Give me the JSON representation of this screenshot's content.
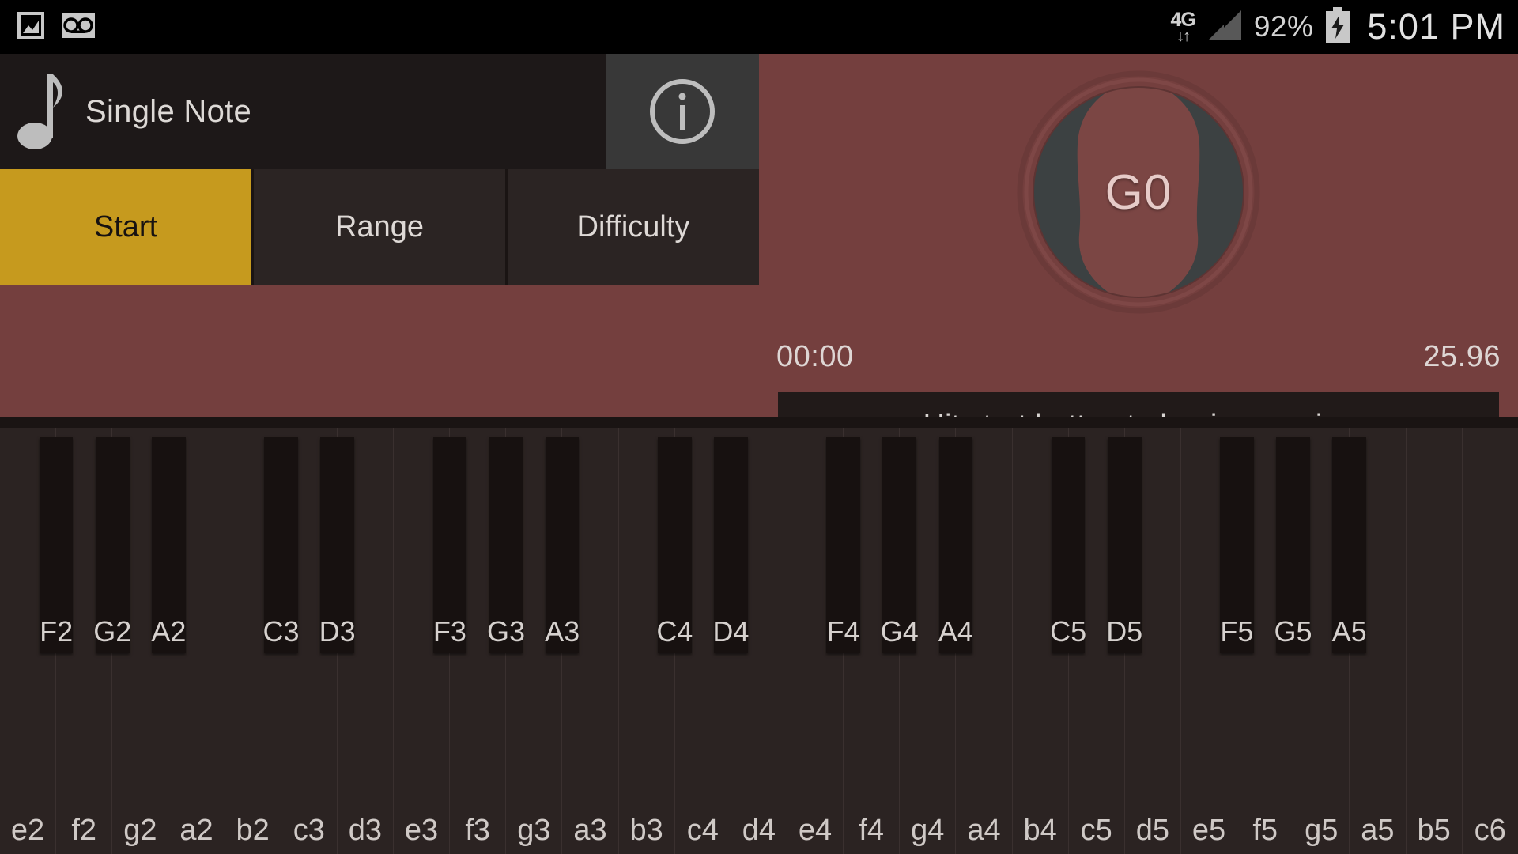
{
  "statusbar": {
    "icons": [
      "screenshot-icon",
      "voicemail-icon"
    ],
    "network_label": "4G",
    "network_arrows": "↓↑",
    "battery_percent": "92%",
    "clock": "5:01 PM"
  },
  "header": {
    "icon": "music-note-icon",
    "title": "Single Note",
    "info_button": "i"
  },
  "tabs": [
    {
      "label": "Start",
      "active": true
    },
    {
      "label": "Range",
      "active": false
    },
    {
      "label": "Difficulty",
      "active": false
    }
  ],
  "gauge": {
    "note": "G0",
    "elapsed": "00:00",
    "total": "25.96"
  },
  "status_message": "Hit start button to begin exercise",
  "keyboard": {
    "white_keys": [
      "e2",
      "f2",
      "g2",
      "a2",
      "b2",
      "c3",
      "d3",
      "e3",
      "f3",
      "g3",
      "a3",
      "b3",
      "c4",
      "d4",
      "e4",
      "f4",
      "g4",
      "a4",
      "b4",
      "c5",
      "d5",
      "e5",
      "f5",
      "g5",
      "a5",
      "b5",
      "c6"
    ],
    "black_keys": [
      {
        "label": "F2",
        "after_white_index": 1
      },
      {
        "label": "G2",
        "after_white_index": 2
      },
      {
        "label": "A2",
        "after_white_index": 3
      },
      {
        "label": "C3",
        "after_white_index": 5
      },
      {
        "label": "D3",
        "after_white_index": 6
      },
      {
        "label": "F3",
        "after_white_index": 8
      },
      {
        "label": "G3",
        "after_white_index": 9
      },
      {
        "label": "A3",
        "after_white_index": 10
      },
      {
        "label": "C4",
        "after_white_index": 12
      },
      {
        "label": "D4",
        "after_white_index": 13
      },
      {
        "label": "F4",
        "after_white_index": 15
      },
      {
        "label": "G4",
        "after_white_index": 16
      },
      {
        "label": "A4",
        "after_white_index": 17
      },
      {
        "label": "C5",
        "after_white_index": 19
      },
      {
        "label": "D5",
        "after_white_index": 20
      },
      {
        "label": "F5",
        "after_white_index": 22
      },
      {
        "label": "G5",
        "after_white_index": 23
      },
      {
        "label": "A5",
        "after_white_index": 24
      }
    ]
  },
  "colors": {
    "maroon": "#743f3e",
    "accent_gold": "#c69a1e",
    "panel_dark": "#2b2423",
    "key_white": "#2b2322",
    "key_black": "#171110"
  }
}
